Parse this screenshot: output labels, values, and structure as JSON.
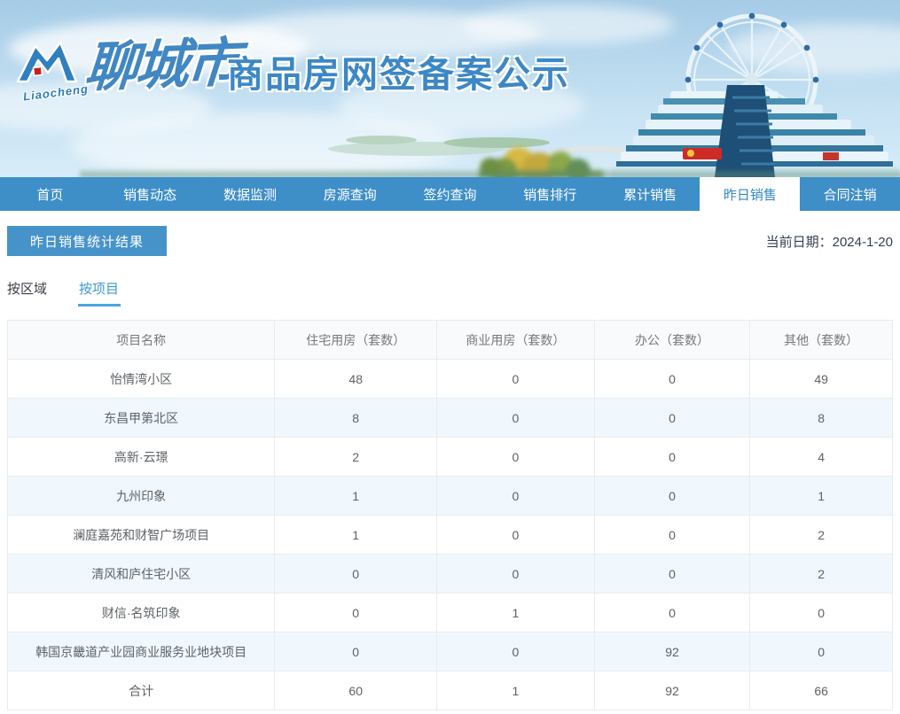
{
  "banner": {
    "logo_script": "Liaocheng",
    "brand_calligraphy": "聊城市",
    "site_title": "商品房网签备案公示"
  },
  "nav": {
    "items": [
      {
        "label": "首页",
        "active": false
      },
      {
        "label": "销售动态",
        "active": false
      },
      {
        "label": "数据监测",
        "active": false
      },
      {
        "label": "房源查询",
        "active": false
      },
      {
        "label": "签约查询",
        "active": false
      },
      {
        "label": "销售排行",
        "active": false
      },
      {
        "label": "累计销售",
        "active": false
      },
      {
        "label": "昨日销售",
        "active": true
      },
      {
        "label": "合同注销",
        "active": false
      }
    ]
  },
  "page": {
    "section_title": "昨日销售统计结果",
    "current_date": "当前日期：2024-1-20"
  },
  "tabs": [
    {
      "label": "按区域",
      "active": false
    },
    {
      "label": "按项目",
      "active": true
    }
  ],
  "table": {
    "headers": [
      "项目名称",
      "住宅用房（套数）",
      "商业用房（套数）",
      "办公（套数）",
      "其他（套数）"
    ],
    "rows": [
      [
        "怡情湾小区",
        "48",
        "0",
        "0",
        "49"
      ],
      [
        "东昌甲第北区",
        "8",
        "0",
        "0",
        "8"
      ],
      [
        "高新·云璟",
        "2",
        "0",
        "0",
        "4"
      ],
      [
        "九州印象",
        "1",
        "0",
        "0",
        "1"
      ],
      [
        "澜庭嘉苑和财智广场项目",
        "1",
        "0",
        "0",
        "2"
      ],
      [
        "清风和庐住宅小区",
        "0",
        "0",
        "0",
        "2"
      ],
      [
        "财信·名筑印象",
        "0",
        "1",
        "0",
        "0"
      ],
      [
        "韩国京畿道产业园商业服务业地块项目",
        "0",
        "0",
        "92",
        "0"
      ],
      [
        "合计",
        "60",
        "1",
        "92",
        "66"
      ]
    ]
  },
  "colors": {
    "nav_blue": "#3e8ec8",
    "badge_blue": "#4693ca",
    "tab_active_blue": "#3e97d3",
    "stripe_blue": "#f0f8fd",
    "brand_blue": "#3c87c6"
  }
}
